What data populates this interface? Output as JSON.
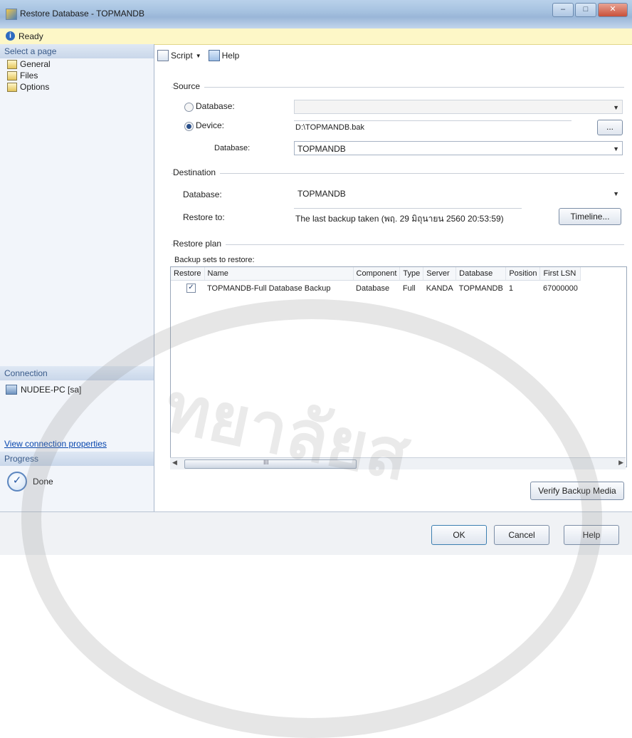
{
  "window": {
    "title": "Restore Database - TOPMANDB",
    "min": "–",
    "max": "□",
    "close": "✕"
  },
  "status": {
    "icon": "info-icon",
    "text": "Ready"
  },
  "left": {
    "select_page_header": "Select a page",
    "pages": [
      "General",
      "Files",
      "Options"
    ],
    "connection_header": "Connection",
    "connection_item": "NUDEE-PC [sa]",
    "view_connection": "View connection properties",
    "progress_header": "Progress",
    "progress_text": "Done"
  },
  "toolbar": {
    "script_label": "Script",
    "help_label": "Help"
  },
  "source": {
    "group_label": "Source",
    "database_radio": "Database:",
    "device_radio": "Device:",
    "device_value": "D:\\TOPMANDB.bak",
    "browse_button": "...",
    "database_label": "Database:",
    "database_value": "TOPMANDB"
  },
  "destination": {
    "group_label": "Destination",
    "database_label": "Database:",
    "database_value": "TOPMANDB",
    "restore_to_label": "Restore to:",
    "restore_to_value": "The last backup taken (พฤ. 29 มิถุนายน 2560 20:53:59)",
    "timeline_button": "Timeline..."
  },
  "restore_plan": {
    "group_label": "Restore plan",
    "backup_sets_label": "Backup sets to restore:",
    "columns": [
      "Restore",
      "Name",
      "Component",
      "Type",
      "Server",
      "Database",
      "Position",
      "First LSN"
    ],
    "rows": [
      {
        "restore": true,
        "name": "TOPMANDB-Full Database Backup",
        "component": "Database",
        "type": "Full",
        "server": "KANDA",
        "database": "TOPMANDB",
        "position": "1",
        "first_lsn": "67000000"
      }
    ],
    "scroll_mark": "III"
  },
  "buttons": {
    "verify": "Verify Backup Media",
    "ok": "OK",
    "cancel": "Cancel",
    "help": "Help"
  },
  "watermark_text": "ทยาลัยส"
}
